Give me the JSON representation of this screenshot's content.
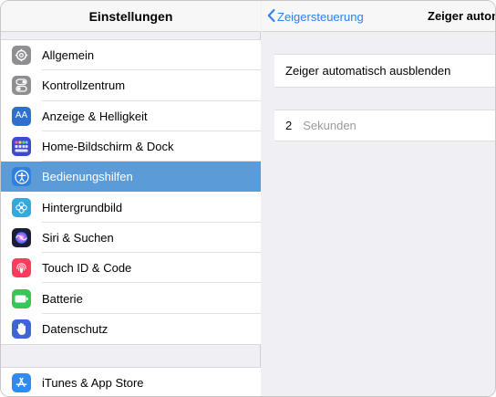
{
  "sidebar": {
    "title": "Einstellungen",
    "items": [
      {
        "label": "Allgemein",
        "icon": "gear-icon",
        "color": "#8e8e93"
      },
      {
        "label": "Kontrollzentrum",
        "icon": "toggles-icon",
        "color": "#8e8e93"
      },
      {
        "label": "Anzeige & Helligkeit",
        "icon": "text-size-icon",
        "color": "#2f6fd1"
      },
      {
        "label": "Home-Bildschirm & Dock",
        "icon": "app-grid-icon",
        "color": "#3d4ad0"
      },
      {
        "label": "Bedienungshilfen",
        "icon": "accessibility-icon",
        "color": "#2f7fe0",
        "selected": true
      },
      {
        "label": "Hintergrundbild",
        "icon": "flower-icon",
        "color": "#34aadc"
      },
      {
        "label": "Siri & Suchen",
        "icon": "siri-icon",
        "color": "#222244"
      },
      {
        "label": "Touch ID & Code",
        "icon": "fingerprint-icon",
        "color": "#ff3b5c"
      },
      {
        "label": "Batterie",
        "icon": "battery-icon",
        "color": "#34c759"
      },
      {
        "label": "Datenschutz",
        "icon": "hand-icon",
        "color": "#3e64d6"
      }
    ],
    "items2": [
      {
        "label": "iTunes & App Store",
        "icon": "app-store-icon",
        "color": "#2f8bf0"
      }
    ]
  },
  "detail": {
    "back_label": "Zeigersteuerung",
    "title": "Zeiger autom",
    "toggle_label": "Zeiger automatisch ausblenden",
    "seconds_value": "2",
    "seconds_unit": "Sekunden"
  },
  "colors": {
    "accent": "#2f80ed",
    "selected_row": "#5b9bd8"
  }
}
